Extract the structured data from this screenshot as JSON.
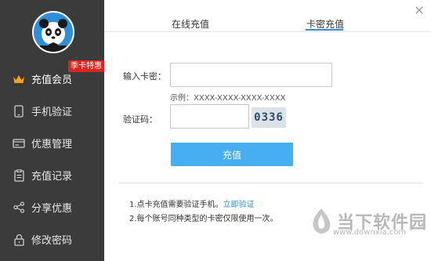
{
  "sidebar": {
    "items": [
      {
        "label": "充值会员",
        "icon": "crown-icon",
        "active": true,
        "badge": "季卡特惠"
      },
      {
        "label": "手机验证",
        "icon": "phone-icon"
      },
      {
        "label": "优惠管理",
        "icon": "card-icon"
      },
      {
        "label": "充值记录",
        "icon": "clipboard-icon"
      },
      {
        "label": "分享优惠",
        "icon": "share-icon"
      },
      {
        "label": "修改密码",
        "icon": "lock-icon"
      }
    ]
  },
  "tabs": [
    {
      "label": "在线充值"
    },
    {
      "label": "卡密充值",
      "active": true
    }
  ],
  "form": {
    "card_label": "输入卡密：",
    "card_value": "",
    "example": "示例：XXXX-XXXX-XXXX-XXXX",
    "captcha_label": "验证码：",
    "captcha_value": "",
    "captcha_code": "0336",
    "submit_label": "充值"
  },
  "notes": {
    "line1": "1.点卡充值需要验证手机。",
    "line1_link": "立即验证",
    "line2": "2.每个账号同种类型的卡密仅限使用一次。"
  },
  "watermark": {
    "text": "当下软件园",
    "url": "www.downxia.com"
  },
  "colors": {
    "sidebar_bg": "#3b3b3b",
    "accent": "#46aef1",
    "badge": "#e0231c",
    "crown": "#f0a31c"
  }
}
